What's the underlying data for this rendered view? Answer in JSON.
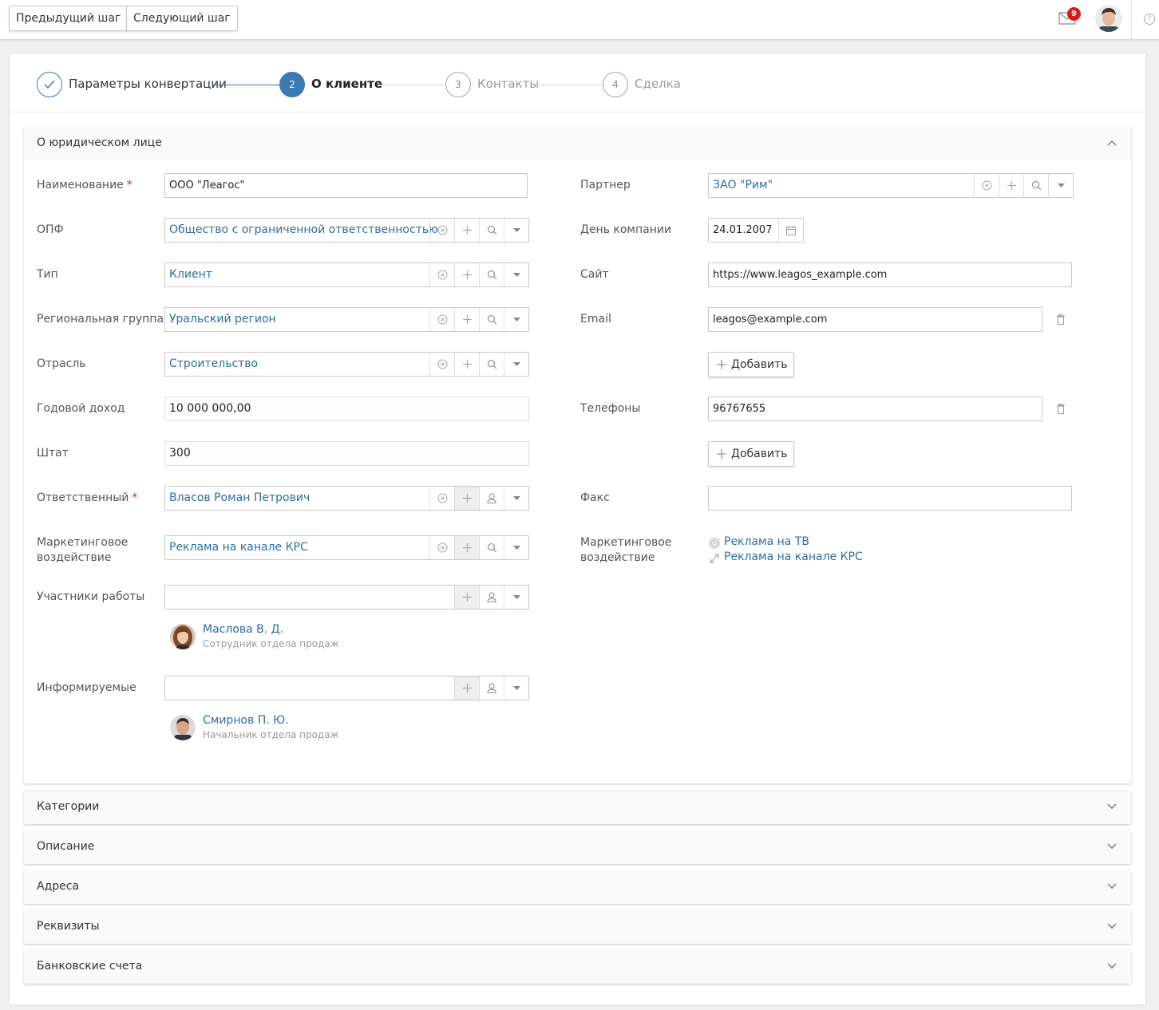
{
  "toolbar": {
    "prev_label": "Предыдущий шаг",
    "next_label": "Следующий шаг",
    "notification_count": "9"
  },
  "steps": [
    {
      "label": "Параметры конвертации",
      "state": "done"
    },
    {
      "label": "О клиенте",
      "number": "2",
      "state": "active"
    },
    {
      "label": "Контакты",
      "number": "3",
      "state": "pending"
    },
    {
      "label": "Сделка",
      "number": "4",
      "state": "pending"
    }
  ],
  "legal": {
    "title": "О юридическом лице",
    "name": {
      "label": "Наименование",
      "value": "ООО \"Леагос\"",
      "required": true
    },
    "opf": {
      "label": "ОПФ",
      "value": "Общество с ограниченной ответственностью"
    },
    "type": {
      "label": "Тип",
      "value": "Клиент"
    },
    "region": {
      "label": "Региональная группа",
      "value": "Уральский регион"
    },
    "industry": {
      "label": "Отрасль",
      "value": "Строительство"
    },
    "revenue": {
      "label": "Годовой доход",
      "value": "10 000 000,00"
    },
    "staff": {
      "label": "Штат",
      "value": "300"
    },
    "responsible": {
      "label": "Ответственный",
      "value": "Власов Роман Петрович",
      "required": true
    },
    "marketing": {
      "label": "Маркетинговое воздействие",
      "value": "Реклама на канале КРС"
    },
    "participants": {
      "label": "Участники работы",
      "value": "",
      "person": {
        "name": "Маслова В. Д.",
        "role": "Сотрудник отдела продаж"
      }
    },
    "informed": {
      "label": "Информируемые",
      "value": "",
      "person": {
        "name": "Смирнов П. Ю.",
        "role": "Начальник отдела продаж"
      }
    },
    "partner": {
      "label": "Партнер",
      "value": "ЗАО \"Рим\""
    },
    "company_day": {
      "label": "День компании",
      "value": "24.01.2007"
    },
    "site": {
      "label": "Сайт",
      "value": "https://www.leagos_example.com"
    },
    "email": {
      "label": "Email",
      "value": "leagos@example.com"
    },
    "phones": {
      "label": "Телефоны",
      "value": "96767655"
    },
    "fax": {
      "label": "Факс",
      "value": ""
    },
    "add_label": "Добавить",
    "marketing_links": {
      "label": "Маркетинговое воздействие",
      "items": [
        "Реклама на ТВ",
        "Реклама на канале КРС"
      ]
    }
  },
  "collapsed_sections": [
    "Категории",
    "Описание",
    "Адреса",
    "Реквизиты",
    "Банковские счета"
  ],
  "icons": {
    "mail": "mail-icon",
    "check": "check-icon",
    "clear": "clear-circle-icon",
    "add": "plus-icon",
    "search": "search-icon",
    "dropdown": "caret-down-icon",
    "user": "user-icon",
    "calendar": "calendar-icon",
    "trash": "trash-icon",
    "chevron_up": "chevron-up-icon",
    "chevron_down": "chevron-down-icon",
    "help": "help-icon",
    "target": "target-icon",
    "resize": "resize-arrow-icon"
  },
  "colors": {
    "accent": "#3a7ab0",
    "link": "#2e6da4",
    "required": "#c0292b",
    "badge": "#d21d1d"
  }
}
